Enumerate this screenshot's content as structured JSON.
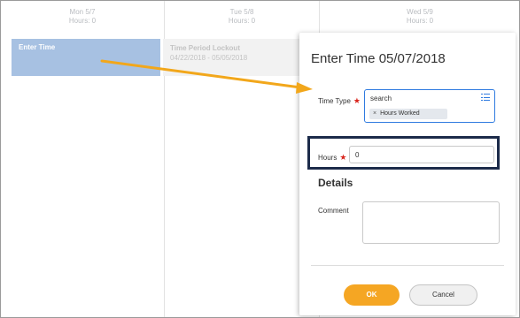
{
  "calendar": {
    "days": [
      {
        "label": "Mon 5/7",
        "hours": "Hours: 0"
      },
      {
        "label": "Tue 5/8",
        "hours": "Hours: 0"
      },
      {
        "label": "Wed 5/9",
        "hours": "Hours: 0"
      }
    ],
    "enter_time_entry": "Enter Time",
    "lockout": {
      "title": "Time Period Lockout",
      "range": "04/22/2018 - 05/05/2018"
    }
  },
  "panel": {
    "title": "Enter Time 05/07/2018",
    "time_type_label": "Time Type",
    "required_mark": "★",
    "time_type_search": "search",
    "time_type_icon": "list-icon",
    "time_type_chip": "Hours Worked",
    "chip_remove": "×",
    "hours_label": "Hours",
    "hours_value": "0",
    "details_heading": "Details",
    "comment_label": "Comment",
    "comment_value": "",
    "ok_label": "OK",
    "cancel_label": "Cancel"
  },
  "colors": {
    "accent_blue": "#2f7be0",
    "enter_time_bg": "#a7c1e2",
    "ok_orange": "#f5a623",
    "arrow_orange": "#f2a71b",
    "highlight_navy": "#1c2b4a",
    "required_red": "#d9251d"
  }
}
